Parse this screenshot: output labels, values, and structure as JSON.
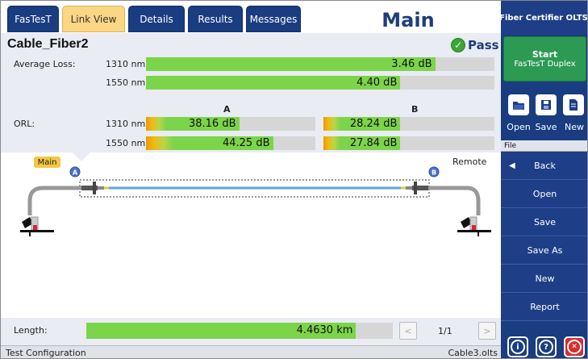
{
  "tabs": [
    {
      "label": "FasTesT"
    },
    {
      "label": "Link View",
      "active": true
    },
    {
      "label": "Details"
    },
    {
      "label": "Results"
    },
    {
      "label": "Messages"
    }
  ],
  "main_title": "Main",
  "cable_name": "Cable_Fiber2",
  "status_result": "Pass",
  "average_loss": {
    "label": "Average Loss:",
    "rows": [
      {
        "wavelength": "1310 nm",
        "value": "3.46 dB",
        "fill_fraction": 0.83
      },
      {
        "wavelength": "1550 nm",
        "value": "4.40 dB",
        "fill_fraction": 0.73
      }
    ]
  },
  "orl": {
    "label": "ORL:",
    "col_a": "A",
    "col_b": "B",
    "rows": [
      {
        "wavelength": "1310 nm",
        "a": "38.16 dB",
        "a_fill": 0.55,
        "b": "28.24 dB",
        "b_fill": 0.45
      },
      {
        "wavelength": "1550 nm",
        "a": "44.25 dB",
        "a_fill": 0.75,
        "b": "27.84 dB",
        "b_fill": 0.45
      }
    ]
  },
  "diagram": {
    "main_badge": "Main",
    "remote_label": "Remote",
    "marker_a": "A",
    "marker_b": "B"
  },
  "length": {
    "label": "Length:",
    "value": "4.4630 km",
    "fill_fraction": 0.88,
    "page": "1/1",
    "prev": "<",
    "next": ">"
  },
  "status_bar": {
    "left": "Test Configuration",
    "right": "Cable3.olts"
  },
  "right_panel": {
    "title": "Fiber Certifier OLTS",
    "start_line1": "Start",
    "start_line2": "FasTesT Duplex",
    "file_buttons": [
      {
        "label": "Open",
        "icon": "folder-open-icon"
      },
      {
        "label": "Save",
        "icon": "floppy-icon"
      },
      {
        "label": "New",
        "icon": "document-icon"
      }
    ],
    "section_label": "File",
    "menu": [
      {
        "label": "Back",
        "icon": "back-arrow-icon"
      },
      {
        "label": "Open"
      },
      {
        "label": "Save"
      },
      {
        "label": "Save As"
      },
      {
        "label": "New"
      },
      {
        "label": "Report"
      }
    ],
    "bottom_buttons": [
      {
        "icon": "info-icon",
        "glyph": "i"
      },
      {
        "icon": "help-icon",
        "glyph": "?"
      },
      {
        "icon": "close-icon",
        "glyph": "✕"
      }
    ]
  },
  "colors": {
    "navy": "#1a3c80",
    "active_tab": "#fbd784",
    "bar_green": "#7cd44a",
    "pass_green": "#3aa635",
    "start_green": "#2d9a54",
    "close_red": "#d32f2f"
  }
}
